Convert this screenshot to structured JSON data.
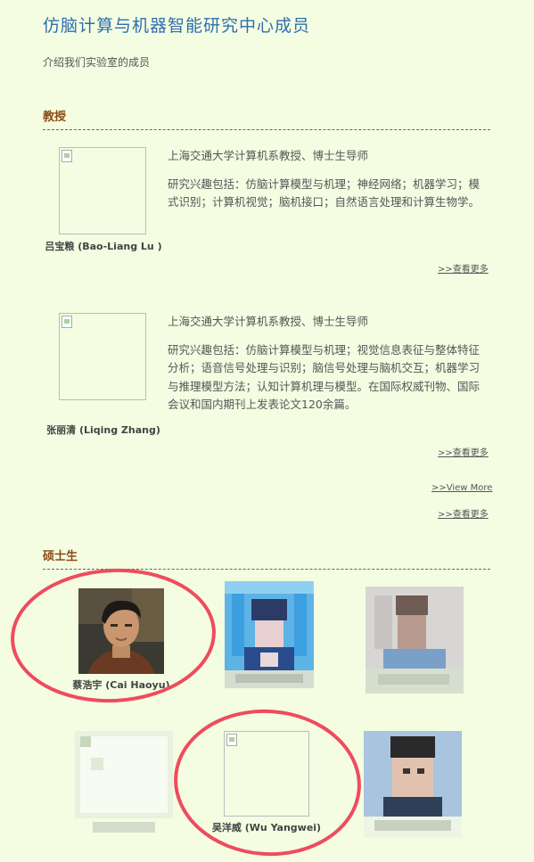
{
  "page": {
    "title": "仿脑计算与机器智能研究中心成员",
    "subtitle": "介绍我们实验室的成员"
  },
  "sections": {
    "professors": {
      "heading": "教授"
    },
    "masters": {
      "heading": "硕士生"
    }
  },
  "professors": [
    {
      "name": "吕宝粮 (Bao-Liang Lu )",
      "position": "上海交通大学计算机系教授、博士生导师",
      "research": "研究兴趣包括：仿脑计算模型与机理；神经网络；机器学习；模式识别；计算机视觉；脑机接口；自然语言处理和计算生物学。",
      "more_link": ">>查看更多"
    },
    {
      "name": "张丽清 (Liqing Zhang)",
      "position": "上海交通大学计算机系教授、博士生导师",
      "research": "研究兴趣包括：仿脑计算模型与机理；视觉信息表征与整体特征分析；语音信号处理与识别；脑信号处理与脑机交互；机器学习与推理模型方法；认知计算机理与模型。在国际权威刊物、国际会议和国内期刊上发表论文120余篇。",
      "more_link": ">>查看更多"
    }
  ],
  "section_links": {
    "view_more": ">>View More",
    "more_cn": ">>查看更多"
  },
  "masters": [
    {
      "name": "蔡浩宇 (Cai Haoyu)"
    },
    {
      "name": "吴洋威 (Wu Yangwei)"
    }
  ],
  "colors": {
    "background": "#f4fde2",
    "title": "#2f6fb0",
    "section_heading": "#8a4b12",
    "annotation_circle": "#ef4b5e"
  }
}
